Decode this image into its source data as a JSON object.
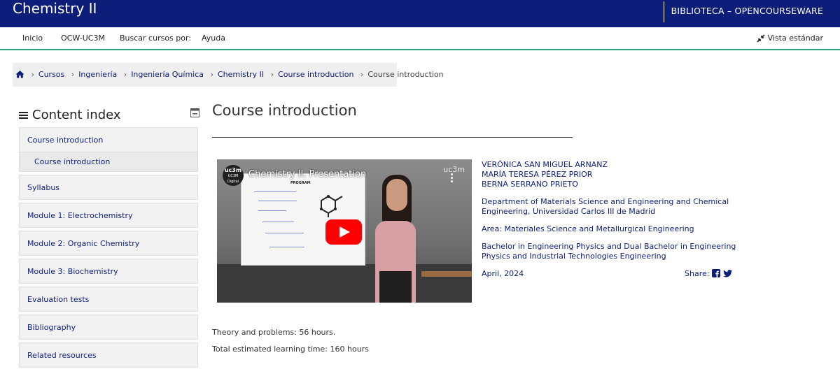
{
  "header": {
    "site_title": "Chemistry II",
    "brand": "BIBLIOTECA – OPENCOURSEWARE"
  },
  "nav": {
    "items": [
      "Inicio",
      "OCW-UC3M",
      "Buscar cursos por:",
      "Ayuda"
    ],
    "view_mode": "Vista estándar"
  },
  "breadcrumb": {
    "items": [
      "Cursos",
      "Ingeniería",
      "Ingeniería Química",
      "Chemistry II",
      "Course introduction"
    ],
    "current": "Course introduction"
  },
  "sidebar": {
    "title": "Content index",
    "items": [
      {
        "label": "Course introduction"
      },
      {
        "label": "Course introduction"
      },
      {
        "label": "Syllabus"
      },
      {
        "label": "Module 1: Electrochemistry"
      },
      {
        "label": "Module 2: Organic Chemistry"
      },
      {
        "label": "Module 3: Biochemistry"
      },
      {
        "label": "Evaluation tests"
      },
      {
        "label": "Bibliography"
      },
      {
        "label": "Related resources"
      }
    ]
  },
  "main": {
    "title": "Course introduction",
    "video": {
      "title": "Chemistry II. Presentation",
      "brand": "uc3m",
      "logo_top": "uc3m",
      "logo_bottom": "UC3M Digital",
      "slide_heading": "PROGRAM"
    },
    "authors": [
      "VERÓNICA SAN MIGUEL ARNANZ",
      "MARÍA TERESA PÉREZ PRIOR",
      "BERNA SERRANO PRIETO"
    ],
    "department": "Department of Materials Science and Engineering and Chemical Engineering, Universidad Carlos III de Madrid",
    "area": "Area: Materiales Science and Metallurgical Engineering",
    "degree": "Bachelor in Engineering Physics and Dual Bachelor in Engineering Physics and Industrial Technologies Engineering",
    "date": "April, 2024",
    "share_label": "Share:",
    "theory": "Theory and problems: 56 hours.",
    "total_time": "Total estimated learning time: 160 hours"
  },
  "colors": {
    "primary": "#0c1d7a",
    "accent_line": "#2aa37d",
    "youtube_red": "#ff0000"
  }
}
